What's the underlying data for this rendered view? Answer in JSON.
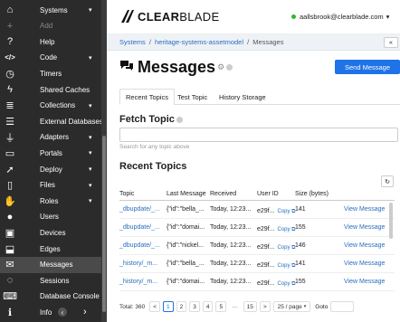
{
  "sidebar": {
    "items": [
      {
        "label": "Systems",
        "icon": "home-icon",
        "glyph": "⌂",
        "caret": true,
        "muted": false
      },
      {
        "label": "Add",
        "icon": "plus-icon",
        "glyph": "+",
        "caret": false,
        "muted": true
      },
      {
        "label": "Help",
        "icon": "question-icon",
        "glyph": "?",
        "caret": false,
        "muted": false
      },
      {
        "label": "Code",
        "icon": "code-icon",
        "glyph": "</>",
        "caret": true,
        "muted": false
      },
      {
        "label": "Timers",
        "icon": "clock-icon",
        "glyph": "◷",
        "caret": false,
        "muted": false
      },
      {
        "label": "Shared Caches",
        "icon": "bolt-icon",
        "glyph": "ϟ",
        "caret": false,
        "muted": false
      },
      {
        "label": "Collections",
        "icon": "database-icon",
        "glyph": "≣",
        "caret": true,
        "muted": false
      },
      {
        "label": "External Databases",
        "icon": "server-icon",
        "glyph": "☰",
        "caret": false,
        "muted": false
      },
      {
        "label": "Adapters",
        "icon": "plug-icon",
        "glyph": "⏚",
        "caret": true,
        "muted": false
      },
      {
        "label": "Portals",
        "icon": "monitor-icon",
        "glyph": "▭",
        "caret": true,
        "muted": false
      },
      {
        "label": "Deploy",
        "icon": "rocket-icon",
        "glyph": "➚",
        "caret": true,
        "muted": false
      },
      {
        "label": "Files",
        "icon": "file-icon",
        "glyph": "▯",
        "caret": true,
        "muted": false
      },
      {
        "label": "Roles",
        "icon": "roles-icon",
        "glyph": "✋",
        "caret": true,
        "muted": false
      },
      {
        "label": "Users",
        "icon": "user-icon",
        "glyph": "●",
        "caret": false,
        "muted": false
      },
      {
        "label": "Devices",
        "icon": "devices-icon",
        "glyph": "▣",
        "caret": false,
        "muted": false
      },
      {
        "label": "Edges",
        "icon": "edges-icon",
        "glyph": "⬓",
        "caret": false,
        "muted": false
      },
      {
        "label": "Messages",
        "icon": "messages-icon",
        "glyph": "✉",
        "caret": false,
        "muted": false,
        "active": true
      },
      {
        "label": "Sessions",
        "icon": "sessions-icon",
        "glyph": "◌",
        "caret": false,
        "muted": false
      },
      {
        "label": "Database Console",
        "icon": "terminal-icon",
        "glyph": "⌨",
        "caret": false,
        "muted": false
      },
      {
        "label": "Info",
        "icon": "info-icon",
        "glyph": "ℹ",
        "caret": false,
        "muted": false
      }
    ],
    "collapse_glyph": "‹",
    "expand_glyph": "›"
  },
  "header": {
    "logo_bold": "CLEAR",
    "logo_light": "BLADE",
    "user_email": "aallsbrook@clearblade.com",
    "user_caret": "▾",
    "status_color": "#2eb82e"
  },
  "breadcrumb": {
    "systems": "Systems",
    "system": "heritage-systems-assetmodel",
    "current": "Messages",
    "sep": "/",
    "collapse_glyph": "«"
  },
  "page": {
    "title": "Messages",
    "send_button": "Send Message",
    "accent": "#1e73e8"
  },
  "tabs": [
    "Recent Topics",
    "Test Topic",
    "History Storage"
  ],
  "fetch": {
    "title": "Fetch Topic",
    "placeholder": "",
    "hint": "Search for any topic above"
  },
  "recent": {
    "title": "Recent Topics",
    "refresh_glyph": "↻",
    "columns": [
      "Topic",
      "Last Message",
      "Received",
      "User ID",
      "Size (bytes)"
    ],
    "rows": [
      {
        "topic": "_dbupdate/_...",
        "message": "{\"id\":\"bella_...",
        "received": "Today, 12:23...",
        "user": "e29f...",
        "size": "141",
        "action": "View Message"
      },
      {
        "topic": "_dbupdate/_...",
        "message": "{\"id\":\"domai...",
        "received": "Today, 12:23...",
        "user": "e29f...",
        "size": "155",
        "action": "View Message"
      },
      {
        "topic": "_dbupdate/_...",
        "message": "{\"id\":\"nickel...",
        "received": "Today, 12:23...",
        "user": "e29f...",
        "size": "146",
        "action": "View Message"
      },
      {
        "topic": "_history/_m...",
        "message": "{\"id\":\"bella_...",
        "received": "Today, 12:23...",
        "user": "e29f...",
        "size": "141",
        "action": "View Message"
      },
      {
        "topic": "_history/_m...",
        "message": "{\"id\":\"domai...",
        "received": "Today, 12:23...",
        "user": "e29f...",
        "size": "155",
        "action": "View Message"
      }
    ],
    "copy_label": "Copy"
  },
  "pager": {
    "total": "Total: 360",
    "prev": "<",
    "pages": [
      "1",
      "2",
      "3",
      "4",
      "5",
      "···",
      "15"
    ],
    "current_page": "1",
    "next": ">",
    "per_page": "25 / page",
    "goto": "Goto"
  }
}
